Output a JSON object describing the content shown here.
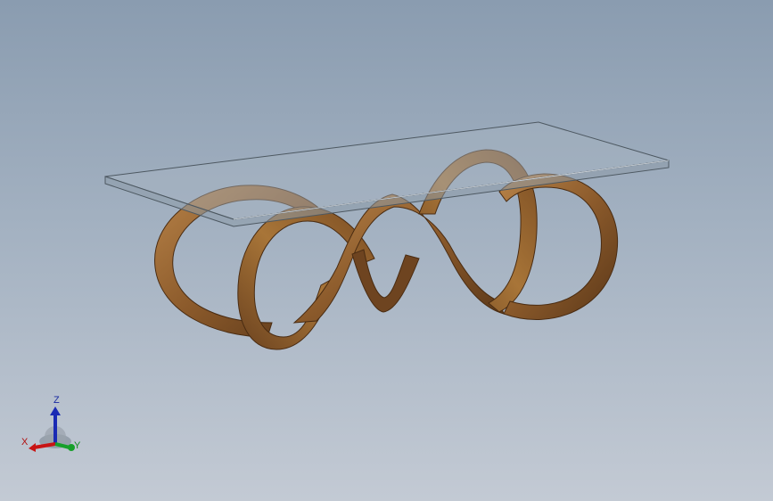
{
  "viewport": {
    "background_top": "#8a9cb0",
    "background_bottom": "#c3cad4"
  },
  "model": {
    "wood_color": "#8b5a2b",
    "wood_highlight": "#b88348",
    "wood_shadow": "#5a3718",
    "glass_color": "#9aa8b6",
    "glass_edge": "#5c6770"
  },
  "triad": {
    "x_label": "X",
    "y_label": "Y",
    "z_label": "Z",
    "x_color": "#c81414",
    "y_color": "#16a02a",
    "z_color": "#1a2ab4"
  }
}
